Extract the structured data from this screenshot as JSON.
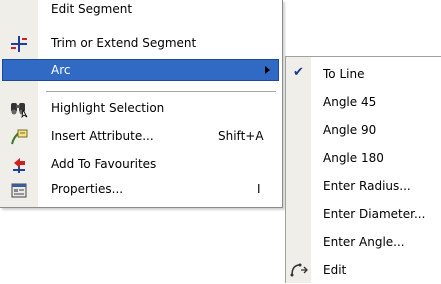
{
  "menu": {
    "items": [
      {
        "label": "Edit Segment"
      },
      {
        "label": "Trim or Extend Segment",
        "icon": "trim-extend-icon"
      },
      {
        "label": "Arc",
        "highlighted": true,
        "has_submenu": true
      },
      {
        "label": "Highlight Selection",
        "icon": "binoculars-icon"
      },
      {
        "label": "Insert Attribute...",
        "shortcut": "Shift+A",
        "icon": "insert-attribute-icon"
      },
      {
        "label": "Add To Favourites",
        "icon": "favourites-icon"
      },
      {
        "label": "Properties...",
        "shortcut": "I",
        "icon": "properties-icon"
      }
    ]
  },
  "submenu": {
    "items": [
      {
        "label": "To Line",
        "checked": true
      },
      {
        "label": "Angle 45"
      },
      {
        "label": "Angle 90"
      },
      {
        "label": "Angle 180"
      },
      {
        "label": "Enter Radius..."
      },
      {
        "label": "Enter Diameter..."
      },
      {
        "label": "Enter Angle..."
      },
      {
        "label": "Edit",
        "icon": "edit-arc-icon"
      }
    ]
  },
  "colors": {
    "highlight": "#316ac5",
    "gutter": "#efeee9",
    "separator": "#a9a79d"
  }
}
